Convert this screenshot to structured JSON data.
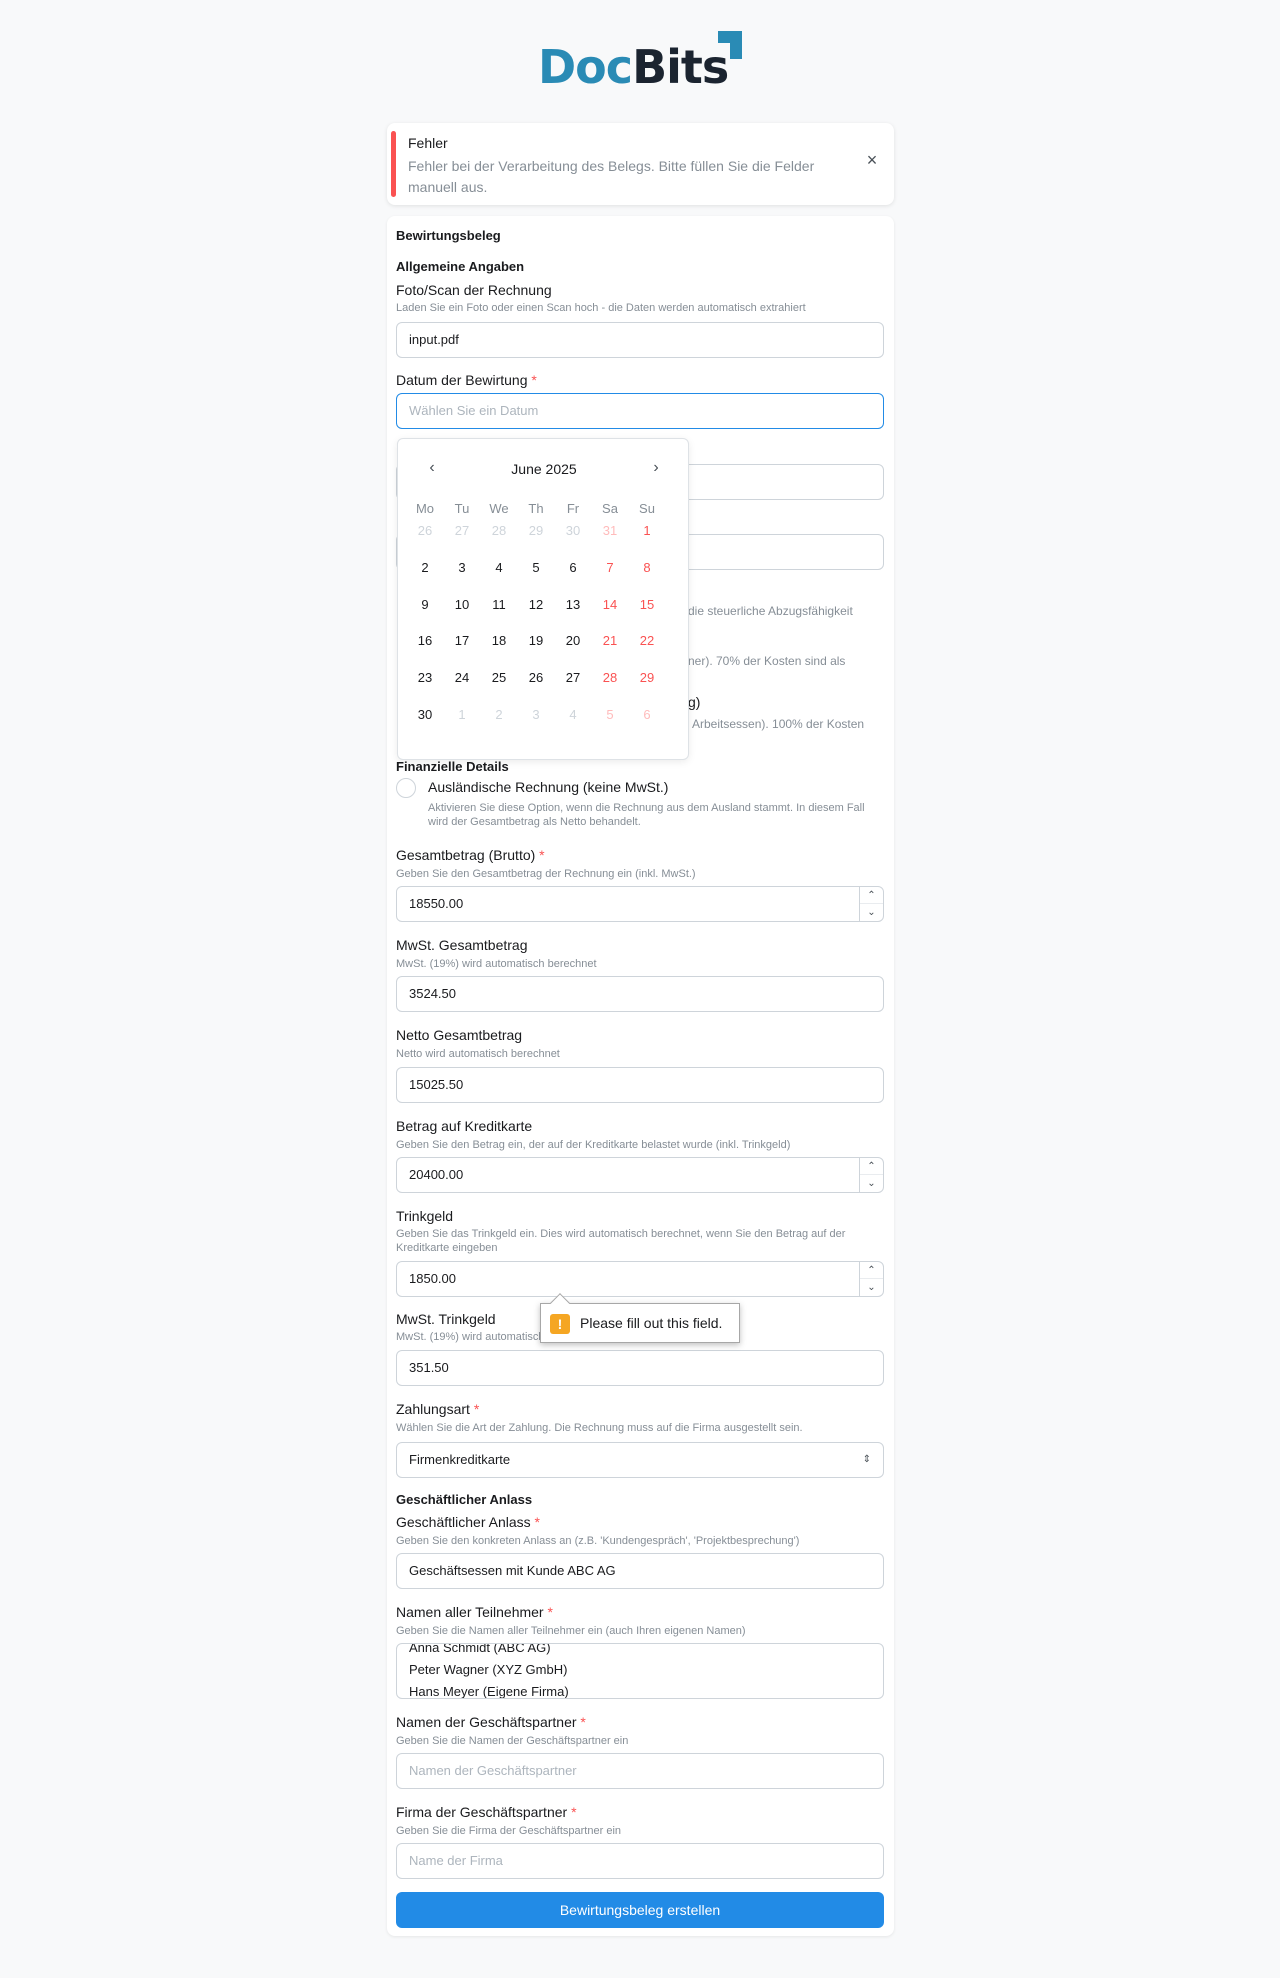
{
  "brand": {
    "part1": "Doc",
    "part2": "Bits",
    "accent_color": "#2a8bb5"
  },
  "alert": {
    "title": "Fehler",
    "message": "Fehler bei der Verarbeitung des Belegs. Bitte füllen Sie die Felder manuell aus.",
    "close_icon": "close-icon",
    "color": "#fa5252"
  },
  "form": {
    "title": "Bewirtungsbeleg",
    "section_general": "Allgemeine Angaben",
    "upload": {
      "label": "Foto/Scan der Rechnung",
      "description": "Laden Sie ein Foto oder einen Scan hoch - die Daten werden automatisch extrahiert",
      "value": "input.pdf"
    },
    "date": {
      "label": "Datum der Bewirtung",
      "required": "*",
      "placeholder": "Wählen Sie ein Datum"
    },
    "hidden_partial": {
      "line1": "die steuerliche Abzugsfähigkeit",
      "line2": "ner). 70% der Kosten sind als",
      "line3": "g)",
      "line4": "Arbeitsessen). 100% der Kosten"
    },
    "section_financial": "Finanzielle Details",
    "foreign": {
      "label": "Ausländische Rechnung (keine MwSt.)",
      "description": "Aktivieren Sie diese Option, wenn die Rechnung aus dem Ausland stammt. In diesem Fall wird der Gesamtbetrag als Netto behandelt."
    },
    "gross": {
      "label": "Gesamtbetrag (Brutto)",
      "required": "*",
      "description": "Geben Sie den Gesamtbetrag der Rechnung ein (inkl. MwSt.)",
      "value": "18550.00"
    },
    "vat_total": {
      "label": "MwSt. Gesamtbetrag",
      "description": "MwSt. (19%) wird automatisch berechnet",
      "value": "3524.50"
    },
    "net_total": {
      "label": "Netto Gesamtbetrag",
      "description": "Netto wird automatisch berechnet",
      "value": "15025.50"
    },
    "card_amount": {
      "label": "Betrag auf Kreditkarte",
      "description": "Geben Sie den Betrag ein, der auf der Kreditkarte belastet wurde (inkl. Trinkgeld)",
      "value": "20400.00"
    },
    "tip": {
      "label": "Trinkgeld",
      "description": "Geben Sie das Trinkgeld ein. Dies wird automatisch berechnet, wenn Sie den Betrag auf der Kreditkarte eingeben",
      "value": "1850.00"
    },
    "tip_vat": {
      "label": "MwSt. Trinkgeld",
      "description": "MwSt. (19%) wird automatisch berechnet",
      "value": "351.50"
    },
    "payment": {
      "label": "Zahlungsart",
      "required": "*",
      "description": "Wählen Sie die Art der Zahlung. Die Rechnung muss auf die Firma ausgestellt sein.",
      "value": "Firmenkreditkarte"
    },
    "section_business": "Geschäftlicher Anlass",
    "occasion": {
      "label": "Geschäftlicher Anlass",
      "required": "*",
      "description": "Geben Sie den konkreten Anlass an (z.B. 'Kundengespräch', 'Projektbesprechung')",
      "value": "Geschäftsessen mit Kunde ABC AG"
    },
    "participants": {
      "label": "Namen aller Teilnehmer",
      "required": "*",
      "description": "Geben Sie die Namen aller Teilnehmer ein (auch Ihren eigenen Namen)",
      "lines": [
        "Anna Schmidt (ABC AG)",
        "Peter Wagner (XYZ GmbH)",
        "Hans Meyer (Eigene Firma)"
      ]
    },
    "partners": {
      "label": "Namen der Geschäftspartner",
      "required": "*",
      "description": "Geben Sie die Namen der Geschäftspartner ein",
      "placeholder": "Namen der Geschäftspartner"
    },
    "partner_company": {
      "label": "Firma der Geschäftspartner",
      "required": "*",
      "description": "Geben Sie die Firma der Geschäftspartner ein",
      "placeholder": "Name der Firma"
    },
    "submit_label": "Bewirtungsbeleg erstellen"
  },
  "calendar": {
    "month_label": "June 2025",
    "prev_icon": "chevron-left-icon",
    "next_icon": "chevron-right-icon",
    "weekdays": [
      "Mo",
      "Tu",
      "We",
      "Th",
      "Fr",
      "Sa",
      "Su"
    ],
    "weeks": [
      [
        "26",
        "27",
        "28",
        "29",
        "30",
        "31",
        "1"
      ],
      [
        "2",
        "3",
        "4",
        "5",
        "6",
        "7",
        "8"
      ],
      [
        "9",
        "10",
        "11",
        "12",
        "13",
        "14",
        "15"
      ],
      [
        "16",
        "17",
        "18",
        "19",
        "20",
        "21",
        "22"
      ],
      [
        "23",
        "24",
        "25",
        "26",
        "27",
        "28",
        "29"
      ],
      [
        "30",
        "1",
        "2",
        "3",
        "4",
        "5",
        "6"
      ]
    ],
    "weekend_color": "#fa5252"
  },
  "tooltip": {
    "text": "Please fill out this field.",
    "icon": "warning-icon"
  }
}
